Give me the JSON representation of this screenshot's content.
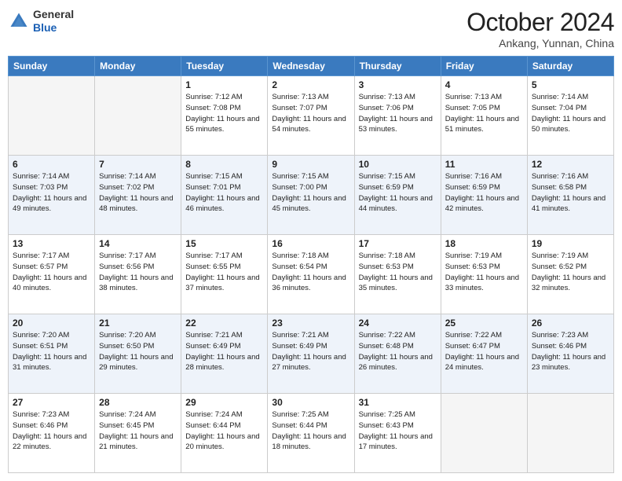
{
  "header": {
    "logo_line1": "General",
    "logo_line2": "Blue",
    "month": "October 2024",
    "location": "Ankang, Yunnan, China"
  },
  "days_of_week": [
    "Sunday",
    "Monday",
    "Tuesday",
    "Wednesday",
    "Thursday",
    "Friday",
    "Saturday"
  ],
  "weeks": [
    [
      {
        "num": "",
        "sunrise": "",
        "sunset": "",
        "daylight": ""
      },
      {
        "num": "",
        "sunrise": "",
        "sunset": "",
        "daylight": ""
      },
      {
        "num": "1",
        "sunrise": "Sunrise: 7:12 AM",
        "sunset": "Sunset: 7:08 PM",
        "daylight": "Daylight: 11 hours and 55 minutes."
      },
      {
        "num": "2",
        "sunrise": "Sunrise: 7:13 AM",
        "sunset": "Sunset: 7:07 PM",
        "daylight": "Daylight: 11 hours and 54 minutes."
      },
      {
        "num": "3",
        "sunrise": "Sunrise: 7:13 AM",
        "sunset": "Sunset: 7:06 PM",
        "daylight": "Daylight: 11 hours and 53 minutes."
      },
      {
        "num": "4",
        "sunrise": "Sunrise: 7:13 AM",
        "sunset": "Sunset: 7:05 PM",
        "daylight": "Daylight: 11 hours and 51 minutes."
      },
      {
        "num": "5",
        "sunrise": "Sunrise: 7:14 AM",
        "sunset": "Sunset: 7:04 PM",
        "daylight": "Daylight: 11 hours and 50 minutes."
      }
    ],
    [
      {
        "num": "6",
        "sunrise": "Sunrise: 7:14 AM",
        "sunset": "Sunset: 7:03 PM",
        "daylight": "Daylight: 11 hours and 49 minutes."
      },
      {
        "num": "7",
        "sunrise": "Sunrise: 7:14 AM",
        "sunset": "Sunset: 7:02 PM",
        "daylight": "Daylight: 11 hours and 48 minutes."
      },
      {
        "num": "8",
        "sunrise": "Sunrise: 7:15 AM",
        "sunset": "Sunset: 7:01 PM",
        "daylight": "Daylight: 11 hours and 46 minutes."
      },
      {
        "num": "9",
        "sunrise": "Sunrise: 7:15 AM",
        "sunset": "Sunset: 7:00 PM",
        "daylight": "Daylight: 11 hours and 45 minutes."
      },
      {
        "num": "10",
        "sunrise": "Sunrise: 7:15 AM",
        "sunset": "Sunset: 6:59 PM",
        "daylight": "Daylight: 11 hours and 44 minutes."
      },
      {
        "num": "11",
        "sunrise": "Sunrise: 7:16 AM",
        "sunset": "Sunset: 6:59 PM",
        "daylight": "Daylight: 11 hours and 42 minutes."
      },
      {
        "num": "12",
        "sunrise": "Sunrise: 7:16 AM",
        "sunset": "Sunset: 6:58 PM",
        "daylight": "Daylight: 11 hours and 41 minutes."
      }
    ],
    [
      {
        "num": "13",
        "sunrise": "Sunrise: 7:17 AM",
        "sunset": "Sunset: 6:57 PM",
        "daylight": "Daylight: 11 hours and 40 minutes."
      },
      {
        "num": "14",
        "sunrise": "Sunrise: 7:17 AM",
        "sunset": "Sunset: 6:56 PM",
        "daylight": "Daylight: 11 hours and 38 minutes."
      },
      {
        "num": "15",
        "sunrise": "Sunrise: 7:17 AM",
        "sunset": "Sunset: 6:55 PM",
        "daylight": "Daylight: 11 hours and 37 minutes."
      },
      {
        "num": "16",
        "sunrise": "Sunrise: 7:18 AM",
        "sunset": "Sunset: 6:54 PM",
        "daylight": "Daylight: 11 hours and 36 minutes."
      },
      {
        "num": "17",
        "sunrise": "Sunrise: 7:18 AM",
        "sunset": "Sunset: 6:53 PM",
        "daylight": "Daylight: 11 hours and 35 minutes."
      },
      {
        "num": "18",
        "sunrise": "Sunrise: 7:19 AM",
        "sunset": "Sunset: 6:53 PM",
        "daylight": "Daylight: 11 hours and 33 minutes."
      },
      {
        "num": "19",
        "sunrise": "Sunrise: 7:19 AM",
        "sunset": "Sunset: 6:52 PM",
        "daylight": "Daylight: 11 hours and 32 minutes."
      }
    ],
    [
      {
        "num": "20",
        "sunrise": "Sunrise: 7:20 AM",
        "sunset": "Sunset: 6:51 PM",
        "daylight": "Daylight: 11 hours and 31 minutes."
      },
      {
        "num": "21",
        "sunrise": "Sunrise: 7:20 AM",
        "sunset": "Sunset: 6:50 PM",
        "daylight": "Daylight: 11 hours and 29 minutes."
      },
      {
        "num": "22",
        "sunrise": "Sunrise: 7:21 AM",
        "sunset": "Sunset: 6:49 PM",
        "daylight": "Daylight: 11 hours and 28 minutes."
      },
      {
        "num": "23",
        "sunrise": "Sunrise: 7:21 AM",
        "sunset": "Sunset: 6:49 PM",
        "daylight": "Daylight: 11 hours and 27 minutes."
      },
      {
        "num": "24",
        "sunrise": "Sunrise: 7:22 AM",
        "sunset": "Sunset: 6:48 PM",
        "daylight": "Daylight: 11 hours and 26 minutes."
      },
      {
        "num": "25",
        "sunrise": "Sunrise: 7:22 AM",
        "sunset": "Sunset: 6:47 PM",
        "daylight": "Daylight: 11 hours and 24 minutes."
      },
      {
        "num": "26",
        "sunrise": "Sunrise: 7:23 AM",
        "sunset": "Sunset: 6:46 PM",
        "daylight": "Daylight: 11 hours and 23 minutes."
      }
    ],
    [
      {
        "num": "27",
        "sunrise": "Sunrise: 7:23 AM",
        "sunset": "Sunset: 6:46 PM",
        "daylight": "Daylight: 11 hours and 22 minutes."
      },
      {
        "num": "28",
        "sunrise": "Sunrise: 7:24 AM",
        "sunset": "Sunset: 6:45 PM",
        "daylight": "Daylight: 11 hours and 21 minutes."
      },
      {
        "num": "29",
        "sunrise": "Sunrise: 7:24 AM",
        "sunset": "Sunset: 6:44 PM",
        "daylight": "Daylight: 11 hours and 20 minutes."
      },
      {
        "num": "30",
        "sunrise": "Sunrise: 7:25 AM",
        "sunset": "Sunset: 6:44 PM",
        "daylight": "Daylight: 11 hours and 18 minutes."
      },
      {
        "num": "31",
        "sunrise": "Sunrise: 7:25 AM",
        "sunset": "Sunset: 6:43 PM",
        "daylight": "Daylight: 11 hours and 17 minutes."
      },
      {
        "num": "",
        "sunrise": "",
        "sunset": "",
        "daylight": ""
      },
      {
        "num": "",
        "sunrise": "",
        "sunset": "",
        "daylight": ""
      }
    ]
  ]
}
